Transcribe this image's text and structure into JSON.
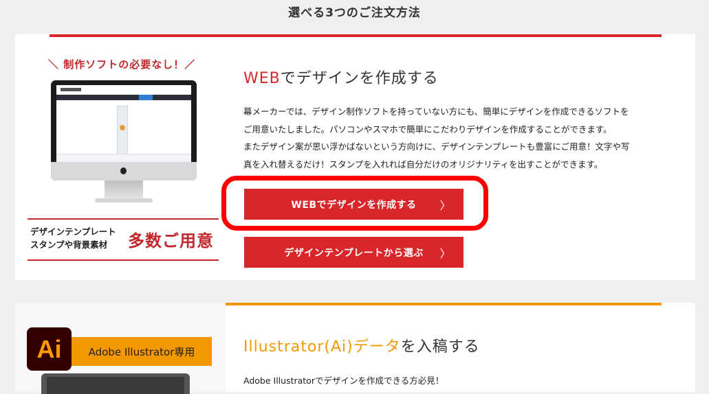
{
  "section_title": "選べる3つのご注文方法",
  "colors": {
    "red": "#d9262a",
    "orange": "#f39800",
    "highlight": "#ff0000"
  },
  "card1": {
    "badge": "＼ 制作ソフトの必要なし！／",
    "promo_line1": "デザインテンプレート",
    "promo_line2": "スタンプや背景素材",
    "promo_big": "多数ご用意",
    "heading_accent": "WEB",
    "heading_rest": "でデザインを作成する",
    "desc_lines": [
      "幕メーカーでは、デザイン制作ソフトを持っていない方にも、簡単にデザインを作成できるソフトを",
      "ご用意いたしました。パソコンやスマホで簡単にこだわりデザインを作成することができます。",
      "またデザイン案が思い浮かばないという方向けに、デザインテンプレートも豊富にご用意！文字や写",
      "真を入れ替えるだけ！スタンプを入れれば自分だけのオリジナリティを出すことができます。"
    ],
    "button1": "WEBでデザインを作成する",
    "button2": "デザインテンプレートから選ぶ",
    "chevron": "〉"
  },
  "card2": {
    "ai_logo": "Ai",
    "ai_label": "Adobe Illustrator専用",
    "heading_accent": "Illustrator(Ai)データ",
    "heading_rest": "を入稿する",
    "desc": "Adobe Illustratorでデザインを作成できる方必見！"
  }
}
